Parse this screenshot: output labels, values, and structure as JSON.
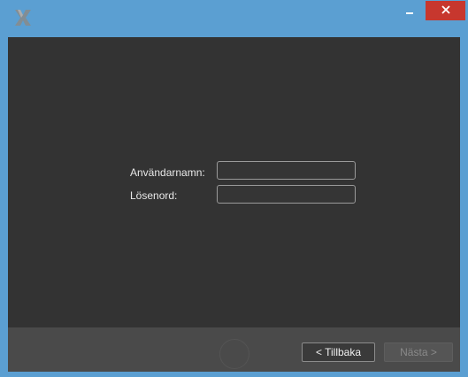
{
  "window": {
    "controls": {
      "minimize": "minimize",
      "maximize": "maximize",
      "close": "close"
    },
    "colors": {
      "title_bar": "#5b9fd2",
      "client_bg": "#333333",
      "footer_bg": "#4a4a4a",
      "close_button": "#c7372e"
    },
    "icons": {
      "app": "app-logo-icon",
      "minimize": "minimize-icon",
      "maximize": "maximize-icon",
      "close": "close-icon"
    }
  },
  "login": {
    "username_label": "Användarnamn:",
    "username_value": "",
    "password_label": "Lösenord:",
    "password_value": ""
  },
  "footer": {
    "back_label": "< Tillbaka",
    "next_label": "Nästa >",
    "next_enabled": false
  }
}
